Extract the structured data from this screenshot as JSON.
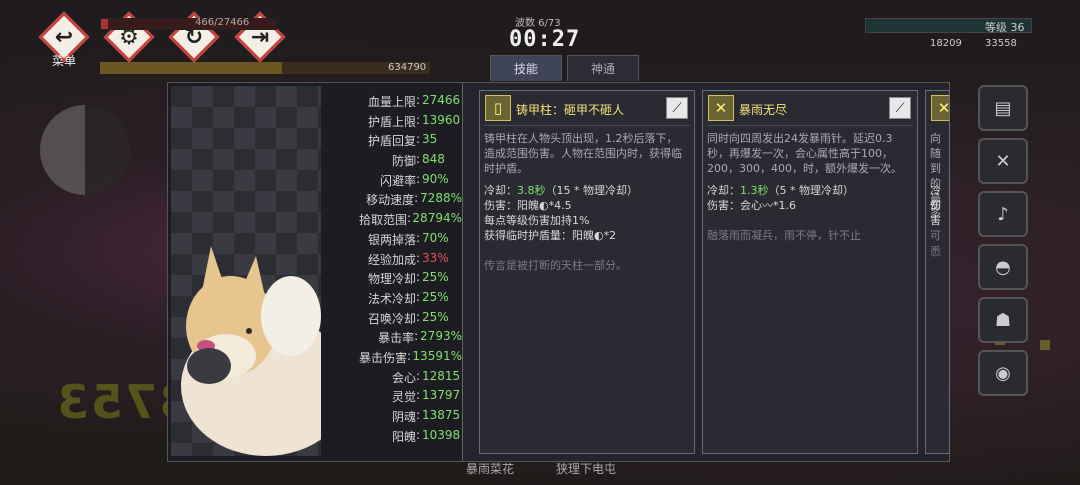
{
  "hud": {
    "menu_label": "菜单",
    "buttons": [
      "back",
      "settings",
      "restart",
      "exit"
    ],
    "hp_text": "466/27466",
    "xp_text": "634790",
    "wave_text": "波数 6/73",
    "timer": "00:27",
    "level_text": "等级 36",
    "currency1": "18209",
    "currency2": "33558",
    "bottom_left": "暴雨菜花",
    "bottom_right": "狭理下电屯"
  },
  "tabs": [
    {
      "label": "技能",
      "active": true
    },
    {
      "label": "神通",
      "active": false
    }
  ],
  "stats": [
    {
      "label": "血量上限",
      "value": "27466",
      "color": "green"
    },
    {
      "label": "护盾上限",
      "value": "13960",
      "color": "green"
    },
    {
      "label": "护盾回复",
      "value": "35",
      "color": "green"
    },
    {
      "label": "防御",
      "value": "848",
      "color": "green"
    },
    {
      "label": "闪避率",
      "value": "90%",
      "color": "green"
    },
    {
      "label": "移动速度",
      "value": "7288%",
      "color": "green"
    },
    {
      "label": "拾取范围",
      "value": "28794%",
      "color": "green"
    },
    {
      "label": "银两掉落",
      "value": "70%",
      "color": "green"
    },
    {
      "label": "经验加成",
      "value": "33%",
      "color": "red"
    },
    {
      "label": "物理冷却",
      "value": "25%",
      "color": "green"
    },
    {
      "label": "法术冷却",
      "value": "25%",
      "color": "green"
    },
    {
      "label": "召唤冷却",
      "value": "25%",
      "color": "green"
    },
    {
      "label": "暴击率",
      "value": "2793%",
      "color": "green"
    },
    {
      "label": "暴击伤害",
      "value": "13591%",
      "color": "green"
    },
    {
      "label": "会心",
      "value": "12815",
      "color": "green"
    },
    {
      "label": "灵觉",
      "value": "13797",
      "color": "green"
    },
    {
      "label": "阴魂",
      "value": "13875",
      "color": "green"
    },
    {
      "label": "阳魄",
      "value": "10398",
      "color": "green"
    }
  ],
  "cards": [
    {
      "title": "铸甲柱：砸甲不砸人",
      "icon": "pillar-icon",
      "desc": "铸甲柱在人物头顶出现，1.2秒后落下，造成范围伤害。人物在范围内时，获得临时护盾。",
      "cooldown_label": "冷却：",
      "cooldown_value": "3.8秒",
      "cooldown_formula": "（15 * 物理冷却）",
      "lines": [
        "伤害：阳魄◐*4.5",
        "每点等级伤害加持1%",
        "获得临时护盾量：阳魄◐*2"
      ],
      "lore": "传言是被打断的天柱一部分。"
    },
    {
      "title": "暴雨无尽",
      "icon": "needles-icon",
      "desc": "同时向四周发出24发暴雨针。延迟0.3秒，再爆发一次，会心属性高于100，200，300，400，时，额外爆发一次。",
      "cooldown_label": "冷却：",
      "cooldown_value": "1.3秒",
      "cooldown_formula": "（5 * 物理冷却）",
      "lines": [
        "伤害：会心〰*1.6"
      ],
      "lore": "融落雨而凝兵，雨不停，针不止"
    },
    {
      "title": "",
      "desc": "向随到的最多",
      "cooldown_label": "冷却",
      "lines": [
        "伤害"
      ],
      "lore": "可悉"
    }
  ],
  "side_icons": [
    "scroll-icon",
    "crossed-needles-icon",
    "bell-icon",
    "dome-icon",
    "mask-icon",
    "orb-icon"
  ]
}
